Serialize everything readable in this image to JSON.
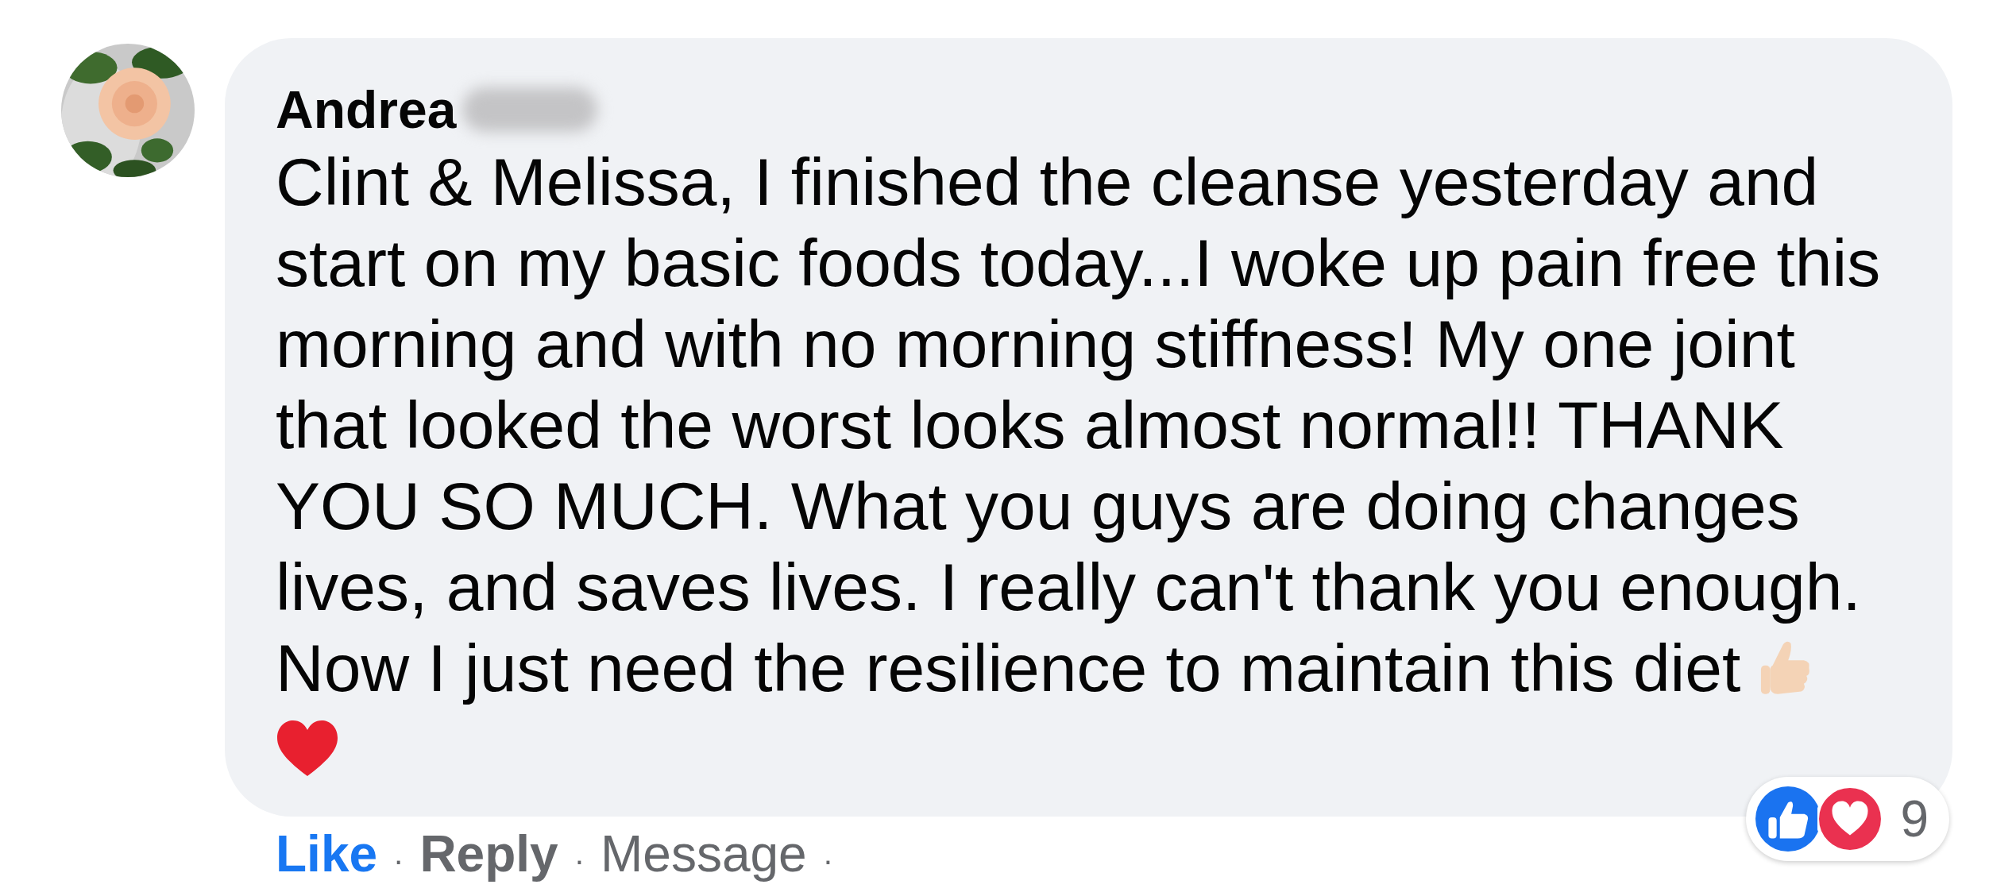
{
  "comment": {
    "author": "Andrea",
    "lines": [
      "Clint & Melissa, I finished the cleanse yesterday and",
      "start on my basic foods today...I woke up pain free this",
      "morning and with no morning stiffness! My one joint",
      "that looked the worst looks almost normal!! THANK",
      "YOU SO MUCH. What you guys are doing changes",
      "lives, and saves lives. I really can't thank you enough.",
      "Now I just need the resilience to maintain this diet"
    ],
    "actions": [
      {
        "label": "Like",
        "kind": "primary",
        "separator": "·"
      },
      {
        "label": "Reply",
        "kind": "strong",
        "separator": "·"
      },
      {
        "label": "Message",
        "kind": "plain",
        "separator": "·"
      }
    ],
    "reactions": {
      "count": "9"
    }
  }
}
